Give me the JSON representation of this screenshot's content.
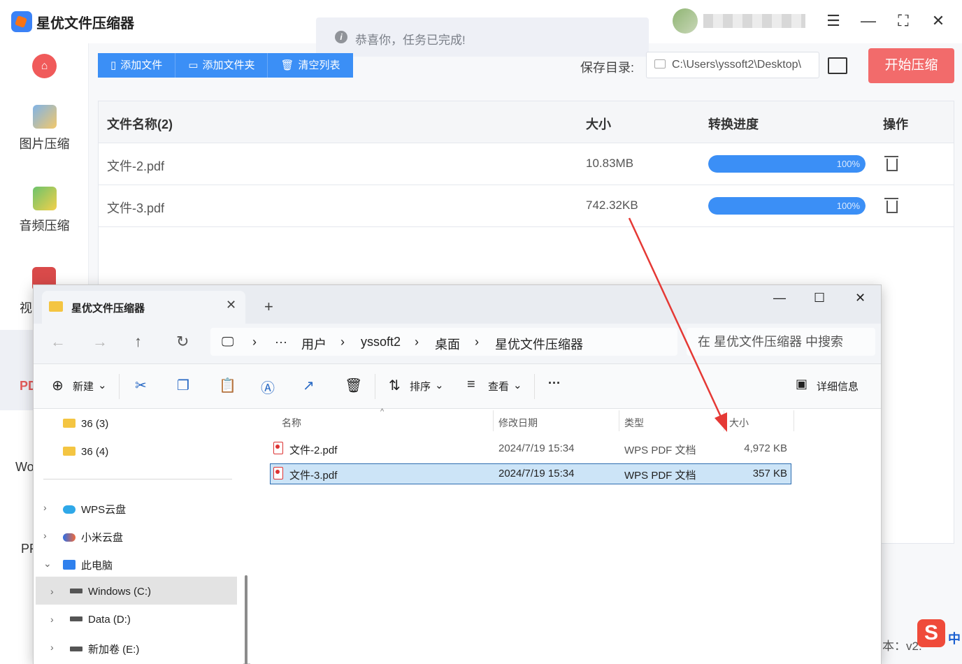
{
  "app": {
    "title": "星优文件压缩器",
    "window_controls": [
      "settings-icon",
      "minimize-icon",
      "maximize-icon",
      "close-icon"
    ],
    "toast": "恭喜你，任务已完成!",
    "sidebar": {
      "items": [
        {
          "label": "图片压缩",
          "icon": "image-icon"
        },
        {
          "label": "音频压缩",
          "icon": "audio-icon"
        }
      ],
      "fragments": [
        "视",
        "PD",
        "Wo",
        "PF"
      ]
    },
    "toolbar": {
      "add_file": "添加文件",
      "add_folder": "添加文件夹",
      "clear_list": "清空列表"
    },
    "save_dir_label": "保存目录:",
    "save_dir_value": "C:\\Users\\yssoft2\\Desktop\\",
    "start_button": "开始压缩",
    "table": {
      "headers": [
        "文件名称(2)",
        "大小",
        "转换进度",
        "操作"
      ],
      "rows": [
        {
          "name": "文件-2.pdf",
          "size": "10.83MB",
          "progress": "100%",
          "progress_value": 1.0
        },
        {
          "name": "文件-3.pdf",
          "size": "742.32KB",
          "progress": "100%",
          "progress_value": 1.0
        }
      ]
    },
    "version_fragment": "本：v2.",
    "ime": {
      "logo": "S",
      "mode": "中"
    }
  },
  "explorer": {
    "tab_title": "星优文件压缩器",
    "breadcrumb": [
      "用户",
      "yssoft2",
      "桌面",
      "星优文件压缩器"
    ],
    "search_placeholder": "在 星优文件压缩器 中搜索",
    "commands": {
      "new": "新建",
      "sort": "排序",
      "view": "查看",
      "more": "···",
      "details": "详细信息"
    },
    "tree": [
      {
        "label": "36 (3)",
        "type": "folder"
      },
      {
        "label": "36 (4)",
        "type": "folder"
      },
      {
        "label": "WPS云盘",
        "type": "cloud"
      },
      {
        "label": "小米云盘",
        "type": "cloud"
      },
      {
        "label": "此电脑",
        "type": "pc"
      },
      {
        "label": "Windows (C:)",
        "type": "drive"
      },
      {
        "label": "Data (D:)",
        "type": "drive"
      },
      {
        "label": "新加卷 (E:)",
        "type": "drive"
      }
    ],
    "columns": [
      "名称",
      "修改日期",
      "类型",
      "大小"
    ],
    "files": [
      {
        "name": "文件-2.pdf",
        "date": "2024/7/19 15:34",
        "type": "WPS PDF 文档",
        "size": "4,972 KB"
      },
      {
        "name": "文件-3.pdf",
        "date": "2024/7/19 15:34",
        "type": "WPS PDF 文档",
        "size": "357 KB"
      }
    ]
  },
  "colors": {
    "accent_blue": "#3b8ff6",
    "start_red": "#f26b6b",
    "annotation_arrow": "#e53935",
    "selection": "#cce4f7"
  }
}
